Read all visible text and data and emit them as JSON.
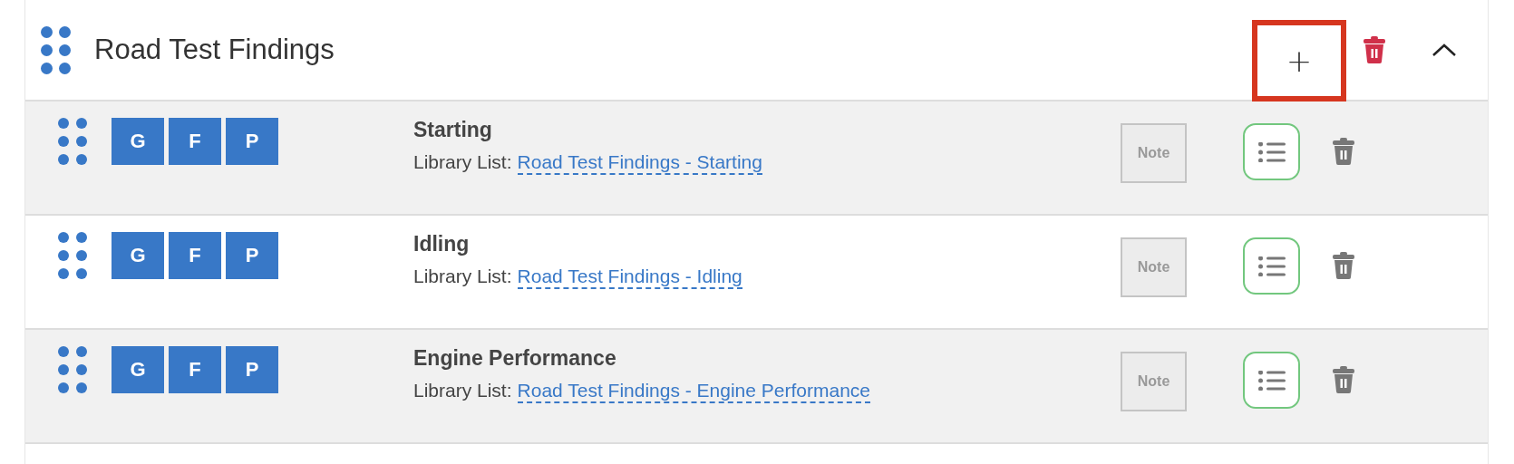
{
  "section": {
    "title": "Road Test Findings",
    "add_button": {
      "label": "+",
      "highlighted": true
    },
    "expanded": true
  },
  "rows": [
    {
      "grade_buttons": [
        "G",
        "F",
        "P"
      ],
      "title": "Starting",
      "library_label": "Library List:",
      "library_link": "Road Test Findings - Starting",
      "note_button": "Note"
    },
    {
      "grade_buttons": [
        "G",
        "F",
        "P"
      ],
      "title": "Idling",
      "library_label": "Library List:",
      "library_link": "Road Test Findings - Idling",
      "note_button": "Note"
    },
    {
      "grade_buttons": [
        "G",
        "F",
        "P"
      ],
      "title": "Engine Performance",
      "library_label": "Library List:",
      "library_link": "Road Test Findings - Engine Performance",
      "note_button": "Note"
    }
  ]
}
